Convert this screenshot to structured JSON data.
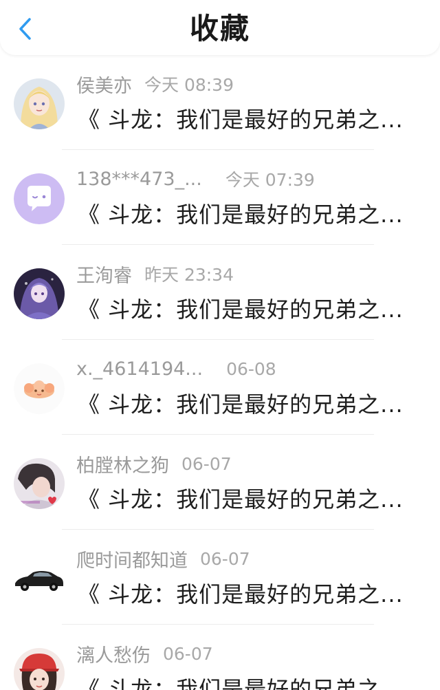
{
  "header": {
    "title": "收藏",
    "back_icon": "chevron-left-icon",
    "accent": "#2f9bf0"
  },
  "items": [
    {
      "user": "侯美亦",
      "time": "今天 08:39",
      "title": "《 斗龙：我们是最好的兄弟之...",
      "avatar_icon": "anime-girl-avatar"
    },
    {
      "user": "138***473_...",
      "time": "今天 07:39",
      "title": "《 斗龙：我们是最好的兄弟之...",
      "avatar_icon": "chat-bubble-avatar",
      "avatar_color": "#cdbcf3"
    },
    {
      "user": "王洵睿",
      "time": "昨天 23:34",
      "title": "《 斗龙：我们是最好的兄弟之...",
      "avatar_icon": "anime-character-avatar"
    },
    {
      "user": "x._4614194...",
      "time": "06-08",
      "title": "《 斗龙：我们是最好的兄弟之...",
      "avatar_icon": "cartoon-avatar"
    },
    {
      "user": "柏膛林之狗",
      "time": "06-07",
      "title": "《 斗龙：我们是最好的兄弟之...",
      "avatar_icon": "photo-avatar"
    },
    {
      "user": "爬时间都知道",
      "time": "06-07",
      "title": "《 斗龙：我们是最好的兄弟之...",
      "avatar_icon": "car-avatar"
    },
    {
      "user": "漓人愁伤",
      "time": "06-07",
      "title": "《 斗龙：我们是最好的兄弟之...",
      "avatar_icon": "girl-photo-avatar"
    }
  ]
}
